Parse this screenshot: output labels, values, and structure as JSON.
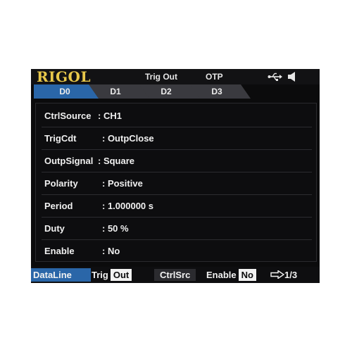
{
  "header": {
    "brand": "RIGOL",
    "mode": "Trig Out",
    "status": "OTP",
    "icons": [
      "usb-icon",
      "speaker-icon"
    ]
  },
  "tabs": [
    "D0",
    "D1",
    "D2",
    "D3"
  ],
  "active_tab": "D0",
  "params": [
    {
      "label": "CtrlSource",
      "value": ": CH1"
    },
    {
      "label": "TrigCdt",
      "value": ": OutpClose"
    },
    {
      "label": "OutpSignal",
      "value": ": Square"
    },
    {
      "label": "Polarity",
      "value": ": Positive"
    },
    {
      "label": "Period",
      "value": ": 1.000000 s"
    },
    {
      "label": "Duty",
      "value": ": 50 %"
    },
    {
      "label": "Enable",
      "value": ": No"
    }
  ],
  "softkeys": {
    "dataline": "DataLine",
    "trig_label": "Trig",
    "trig_value": "Out",
    "ctrlsrc": "CtrlSrc",
    "enable_label": "Enable",
    "enable_value": "No",
    "page": "1/3"
  },
  "colors": {
    "brand": "#e8c84a",
    "tab_active": "#2a66a8",
    "tab_inactive": "#3a3a3f",
    "background": "#0b0b0c"
  }
}
